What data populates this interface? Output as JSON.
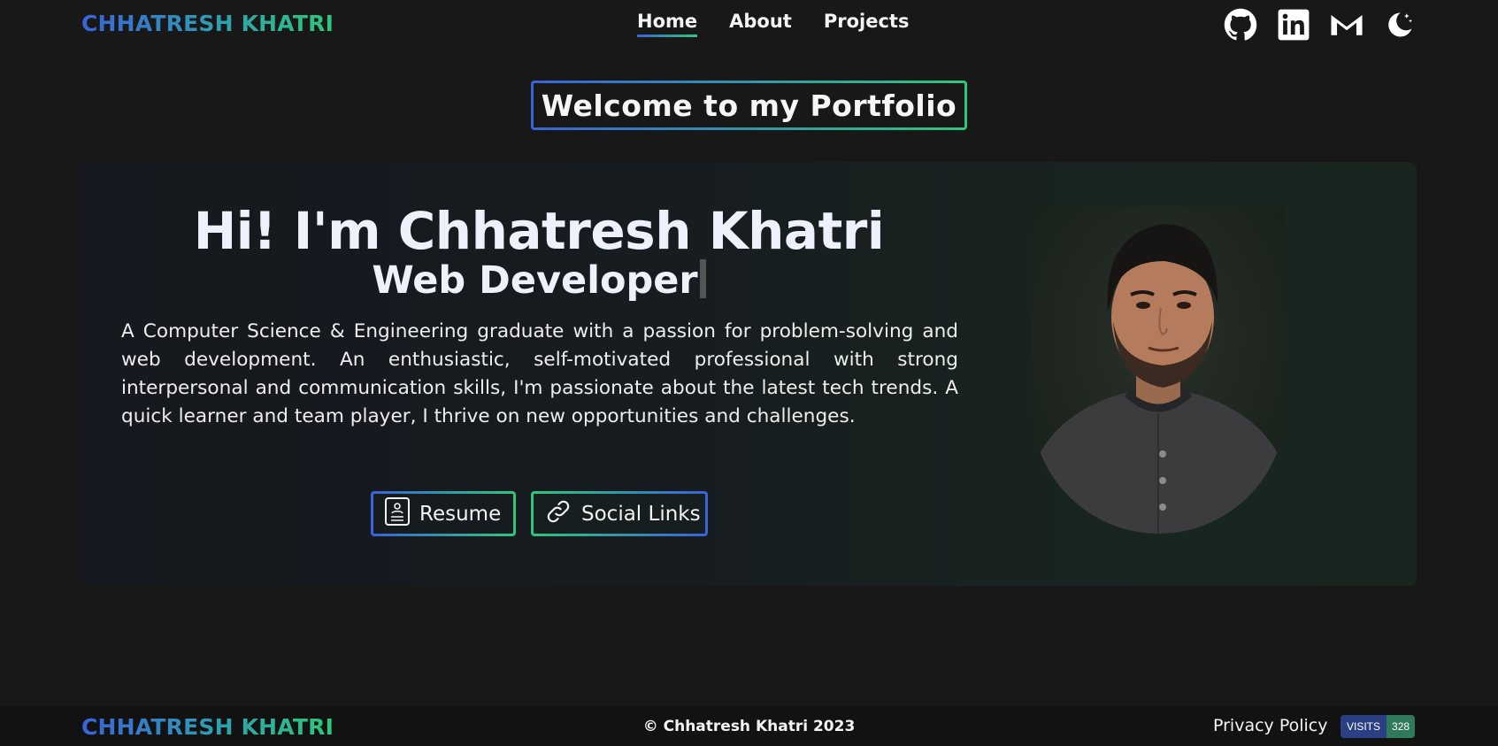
{
  "brand": {
    "name": "CHHATRESH KHATRI"
  },
  "nav": {
    "items": [
      {
        "label": "Home"
      },
      {
        "label": "About"
      },
      {
        "label": "Projects"
      }
    ]
  },
  "header_icons": [
    "github-icon",
    "linkedin-icon",
    "gmail-icon",
    "moon-icon"
  ],
  "welcome": {
    "title": "Welcome to my Portfolio"
  },
  "hero": {
    "name": "Hi! I'm Chhatresh Khatri",
    "role": "Web Developer",
    "bio": "A Computer Science & Engineering graduate with a passion for problem-solving and web development. An enthusiastic, self-motivated professional with strong interpersonal and communication skills, I'm passionate about the latest tech trends. A quick learner and team player, I thrive on new opportunities and challenges.",
    "buttons": {
      "resume": "Resume",
      "social": "Social Links"
    }
  },
  "footer": {
    "brand": "CHHATRESH KHATRI",
    "copyright": "© Chhatresh Khatri 2023",
    "privacy": "Privacy Policy",
    "visits_label": "VISITS",
    "visits_count": "328"
  },
  "colors": {
    "accent_blue": "#3b63d8",
    "accent_green": "#2ec77a",
    "background": "#181818"
  }
}
